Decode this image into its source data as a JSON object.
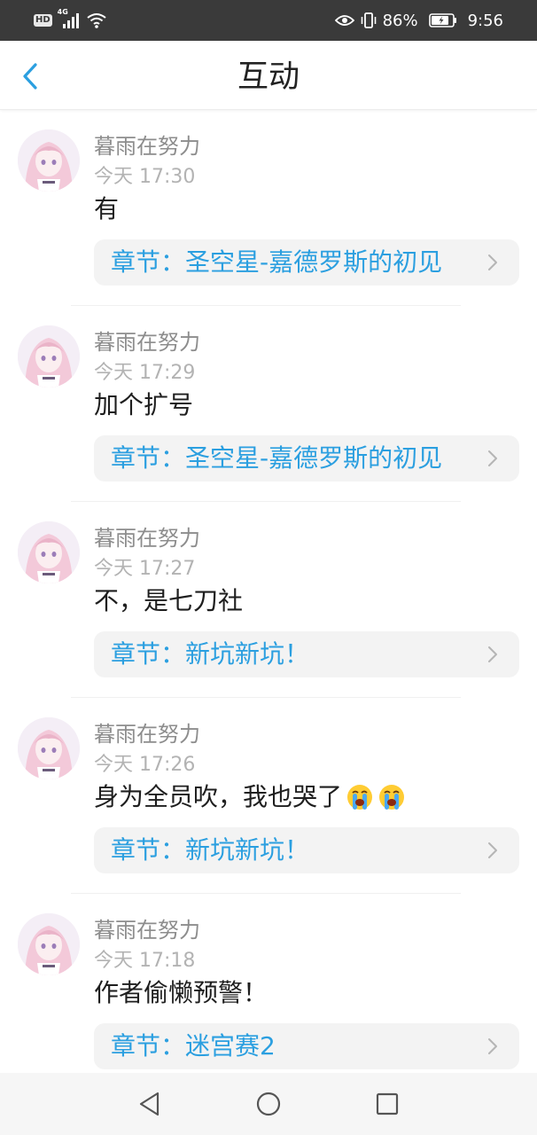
{
  "status_bar": {
    "hd": "HD",
    "network": "4G",
    "battery_percent": "86%",
    "time": "9:56",
    "icons": [
      "hd-icon",
      "signal-icon",
      "wifi-icon",
      "eye-icon",
      "vibrate-icon",
      "battery-icon"
    ]
  },
  "header": {
    "title": "互动",
    "back_icon": "chevron-left-icon"
  },
  "colors": {
    "accent": "#2b9fe0",
    "status_bar_bg": "#3a3a3a",
    "chip_bg": "#f3f3f3",
    "username": "#8d8d8d",
    "timestamp": "#b3b3b3"
  },
  "comments": [
    {
      "username": "暮雨在努力",
      "time": "今天 17:30",
      "text": "有",
      "chapter": "章节：圣空星-嘉德罗斯的初见"
    },
    {
      "username": "暮雨在努力",
      "time": "今天 17:29",
      "text": "加个扩号",
      "chapter": "章节：圣空星-嘉德罗斯的初见"
    },
    {
      "username": "暮雨在努力",
      "time": "今天 17:27",
      "text": "不，是七刀社",
      "chapter": "章节：新坑新坑！"
    },
    {
      "username": "暮雨在努力",
      "time": "今天 17:26",
      "text": "身为全员吹，我也哭了",
      "emoji": [
        "loudly-crying-face-emoji",
        "loudly-crying-face-emoji"
      ],
      "chapter": "章节：新坑新坑！"
    },
    {
      "username": "暮雨在努力",
      "time": "今天 17:18",
      "text": "作者偷懒预警！",
      "chapter": "章节：迷宫赛2"
    }
  ],
  "nav_bar": {
    "buttons": [
      "back-triangle-icon",
      "home-circle-icon",
      "recents-square-icon"
    ]
  }
}
